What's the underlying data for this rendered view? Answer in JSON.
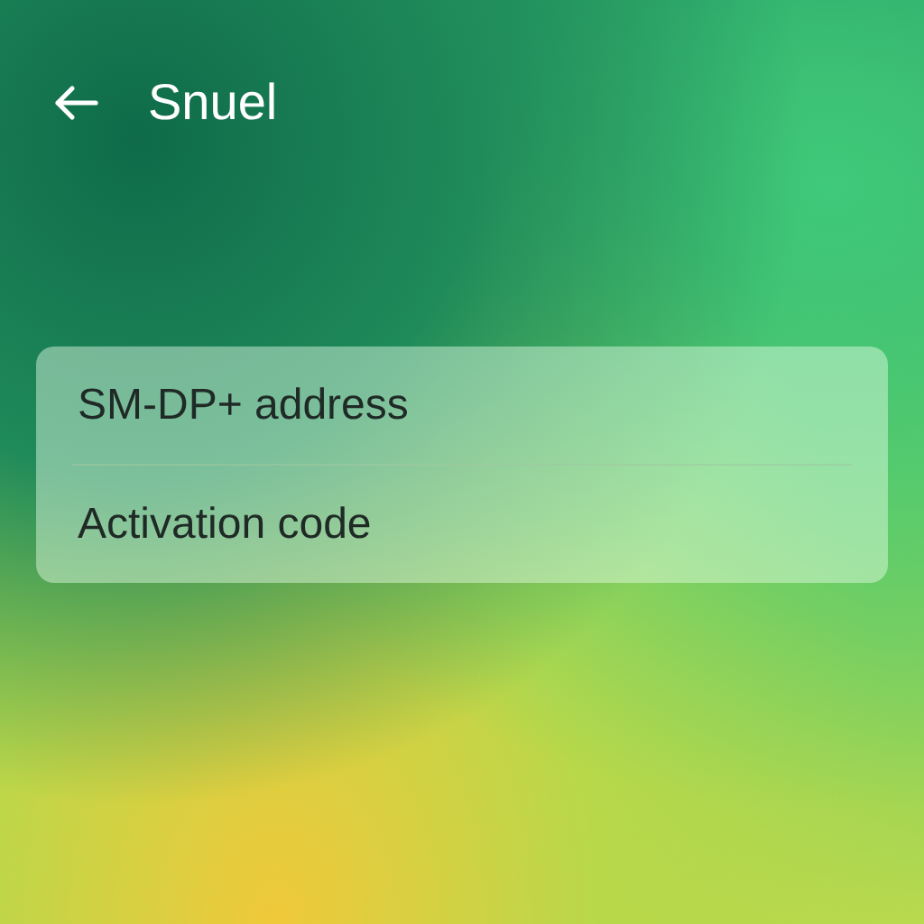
{
  "header": {
    "title": "Snuel"
  },
  "fields": [
    {
      "label": "SM-DP+ address"
    },
    {
      "label": "Activation code"
    }
  ]
}
